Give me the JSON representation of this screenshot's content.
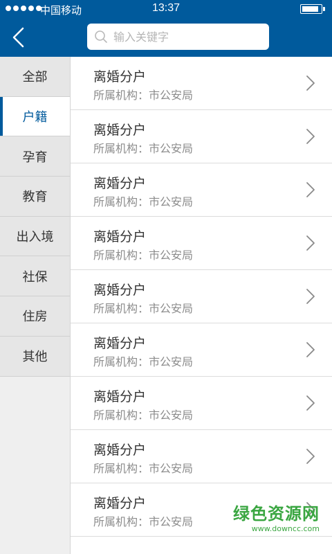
{
  "status_bar": {
    "carrier": "中国移动",
    "time": "13:37",
    "battery_level": 0.9
  },
  "header": {
    "back_icon": "chevron-left-icon",
    "search": {
      "placeholder": "输入关键字",
      "value": "",
      "icon": "search-icon"
    }
  },
  "sidebar": {
    "items": [
      {
        "label": "全部",
        "active": false
      },
      {
        "label": "户籍",
        "active": true
      },
      {
        "label": "孕育",
        "active": false
      },
      {
        "label": "教育",
        "active": false
      },
      {
        "label": "出入境",
        "active": false
      },
      {
        "label": "社保",
        "active": false
      },
      {
        "label": "住房",
        "active": false
      },
      {
        "label": "其他",
        "active": false
      }
    ]
  },
  "list": {
    "items": [
      {
        "title": "离婚分户",
        "subtitle": "所属机构：市公安局"
      },
      {
        "title": "离婚分户",
        "subtitle": "所属机构：市公安局"
      },
      {
        "title": "离婚分户",
        "subtitle": "所属机构：市公安局"
      },
      {
        "title": "离婚分户",
        "subtitle": "所属机构：市公安局"
      },
      {
        "title": "离婚分户",
        "subtitle": "所属机构：市公安局"
      },
      {
        "title": "离婚分户",
        "subtitle": "所属机构：市公安局"
      },
      {
        "title": "离婚分户",
        "subtitle": "所属机构：市公安局"
      },
      {
        "title": "离婚分户",
        "subtitle": "所属机构：市公安局"
      },
      {
        "title": "离婚分户",
        "subtitle": "所属机构：市公安局"
      }
    ]
  },
  "watermark": {
    "name": "绿色资源网",
    "url": "www.downcc.com"
  },
  "colors": {
    "primary": "#005a9c",
    "accent_green": "#3aa641"
  }
}
